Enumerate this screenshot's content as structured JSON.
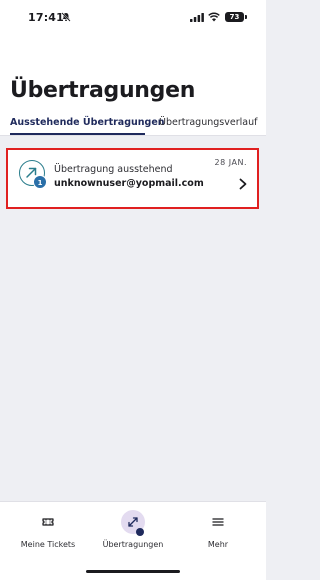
{
  "status_bar": {
    "time": "17:41",
    "battery": "73"
  },
  "header": {
    "title": "Übertragungen",
    "tabs": [
      {
        "label": "Ausstehende Übertragungen",
        "active": true
      },
      {
        "label": "Übertragungsverlauf",
        "active": false
      }
    ]
  },
  "transfers": [
    {
      "badge": "1",
      "title": "Übertragung ausstehend",
      "recipient": "unknownuser@yopmail.com",
      "date": "28 JAN."
    }
  ],
  "bottom_nav": [
    {
      "label": "Meine Tickets",
      "icon": "ticket-icon",
      "active": false
    },
    {
      "label": "Übertragungen",
      "icon": "transfer-icon",
      "active": true
    },
    {
      "label": "Mehr",
      "icon": "menu-icon",
      "active": false
    }
  ],
  "colors": {
    "accent": "#1f2a5c",
    "highlight_border": "#e02020",
    "badge": "#2a6fa8",
    "active_nav_bg": "#e3dbf0"
  }
}
